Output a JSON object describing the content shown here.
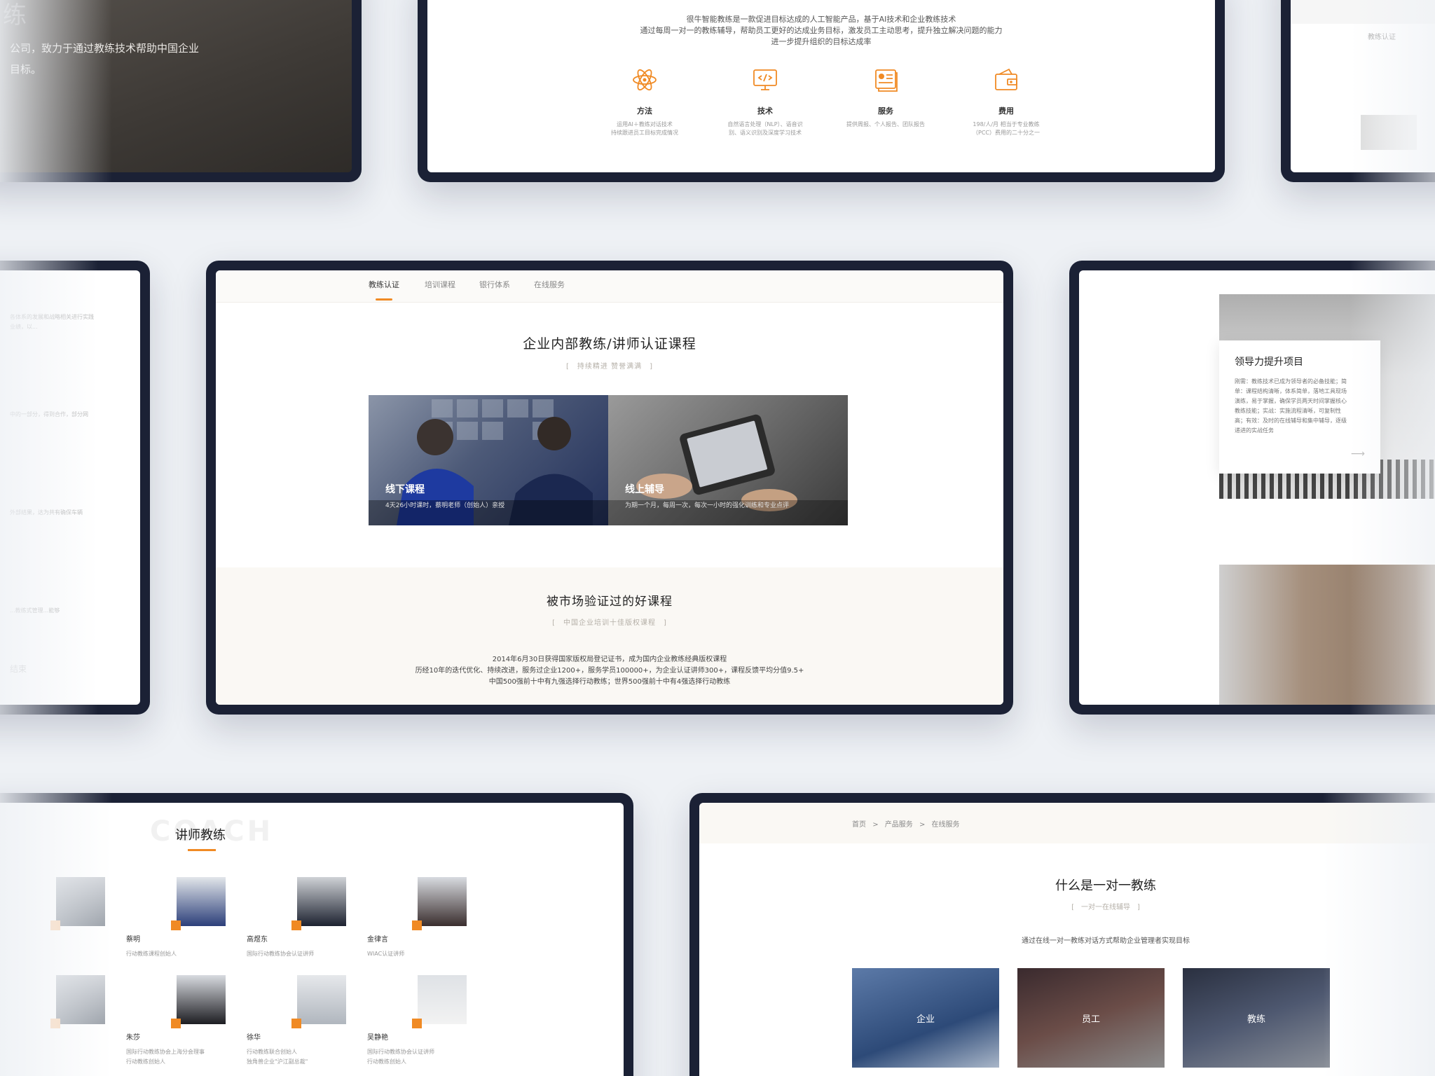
{
  "frame_hero": {
    "line1": "公司，致力于通过教练技术帮助中国企业",
    "line2": "目标。",
    "big_char": "练"
  },
  "frame_intro": {
    "lines": [
      "很牛智能教练是一款促进目标达成的人工智能产品，基于AI技术和企业教练技术",
      "通过每周一对一的教练辅导，帮助员工更好的达成业务目标，激发员工主动思考，提升独立解决问题的能力",
      "进一步提升组织的目标达成率"
    ],
    "features": [
      {
        "icon": "atom-icon",
        "title": "方法",
        "desc1": "运用AI＋教练对话技术",
        "desc2": "持续跟进员工目标完成情况"
      },
      {
        "icon": "monitor-code-icon",
        "title": "技术",
        "desc1": "自然语言处理（NLP）、语音识",
        "desc2": "别、语义识别及深度学习技术"
      },
      {
        "icon": "report-icon",
        "title": "服务",
        "desc1": "提供周报、个人报告、团队报告",
        "desc2": ""
      },
      {
        "icon": "wallet-icon",
        "title": "费用",
        "desc1": "198/人/月 相当于专业教练",
        "desc2": "（PCC）费用的二十分之一"
      }
    ]
  },
  "frame_right_top": {
    "tab": "教练认证"
  },
  "frame_left_mid": {
    "snippets": [
      "各体系的发展和战略相关进行实践",
      "业绩，以...",
      "中的一部分，得到合作，部分网",
      "外部结果，达为共有确保车辆",
      "...教练式管理...能够",
      "结束"
    ]
  },
  "main": {
    "tabs": [
      "教练认证",
      "培训课程",
      "银行体系",
      "在线服务"
    ],
    "title": "企业内部教练/讲师认证课程",
    "subtitle": "[　持续精进  赞誉满满　]",
    "courses": [
      {
        "title": "线下课程",
        "desc": "4天26小时课时，蔡明老师（创始人）亲授"
      },
      {
        "title": "线上辅导",
        "desc": "为期一个月，每周一次，每次一小时的强化训练和专业点评"
      }
    ],
    "section2_title": "被市场验证过的好课程",
    "section2_subtitle": "[　中国企业培训十佳版权课程　]",
    "section2_lines": [
      "2014年6月30日获得国家版权局登记证书，成为国内企业教练经典版权课程",
      "历经10年的迭代优化、持续改进，服务过企业1200+，服务学员100000+，为企业认证讲师300+，课程反馈平均分值9.5+",
      "中国500强前十中有九强选择行动教练；世界500强前十中有4强选择行动教练"
    ]
  },
  "frame_right_mid": {
    "card_title": "领导力提升项目",
    "card_desc": [
      "刚需：教练技术已成为领导者的必备技能；简",
      "单：课程结构清晰，体系简单，落地工具现场",
      "演练，易于掌握，确保学员两天时间掌握核心",
      "教练技能；实战：实施流程清晰，可复制性",
      "高；有效：及时的在线辅导和集中辅导，逐级",
      "递进的实战任务"
    ]
  },
  "coaches": {
    "ghost": "COACH",
    "title": "讲师教练",
    "list": [
      {
        "name": "",
        "role": ""
      },
      {
        "name": "蔡明",
        "role": "行动教练课程创始人"
      },
      {
        "name": "高煜东",
        "role": "国际行动教练协会认证讲师"
      },
      {
        "name": "金律言",
        "role": "WIAC认证讲师"
      },
      {
        "name": "",
        "role": ""
      },
      {
        "name": "朱莎",
        "role": "国际行动教练协会上海分会理事",
        "role2": "行动教练创始人"
      },
      {
        "name": "徐华",
        "role": "行动教练联合创始人",
        "role2": "独角兽企业\"沪江副总裁\""
      },
      {
        "name": "吴静艳",
        "role": "国际行动教练协会认证讲师",
        "role2": "行动教练创始人"
      }
    ]
  },
  "service": {
    "crumbs": [
      "首页",
      "产品服务",
      "在线服务"
    ],
    "sep": ">",
    "title": "什么是一对一教练",
    "subtitle": "[　一对一在线辅导　]",
    "desc": "通过在线一对一教练对话方式帮助企业管理者实现目标",
    "tiles": [
      "企业",
      "员工",
      "教练"
    ]
  },
  "colors": {
    "accent": "#f08a24",
    "frame": "#1b2135",
    "bg": "#eef1f5"
  }
}
